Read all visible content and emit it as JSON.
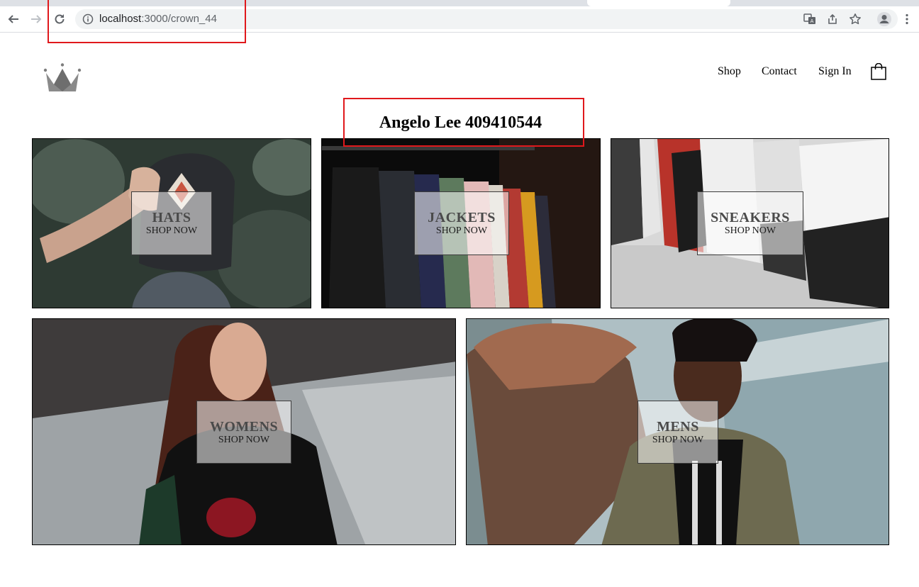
{
  "browser": {
    "url_host": "localhost",
    "url_path": ":3000/crown_44",
    "icons": [
      "back-icon",
      "forward-icon",
      "reload-icon",
      "info-icon",
      "translate-icon",
      "share-icon",
      "star-icon",
      "profile-icon",
      "menu-icon"
    ]
  },
  "header": {
    "logo_icon": "crown-icon",
    "nav": [
      "Shop",
      "Contact",
      "Sign In"
    ],
    "cart_icon": "shopping-bag-icon"
  },
  "page": {
    "title": "Angelo Lee 409410544"
  },
  "directory": [
    {
      "category": "HATS",
      "cta": "SHOP NOW"
    },
    {
      "category": "JACKETS",
      "cta": "SHOP NOW"
    },
    {
      "category": "SNEAKERS",
      "cta": "SHOP NOW"
    },
    {
      "category": "WOMENS",
      "cta": "SHOP NOW"
    },
    {
      "category": "MENS",
      "cta": "SHOP NOW"
    }
  ],
  "colors": {
    "highlight": "#e0181c",
    "toolbar": "#ffffff",
    "omnibox": "#f1f3f4"
  }
}
